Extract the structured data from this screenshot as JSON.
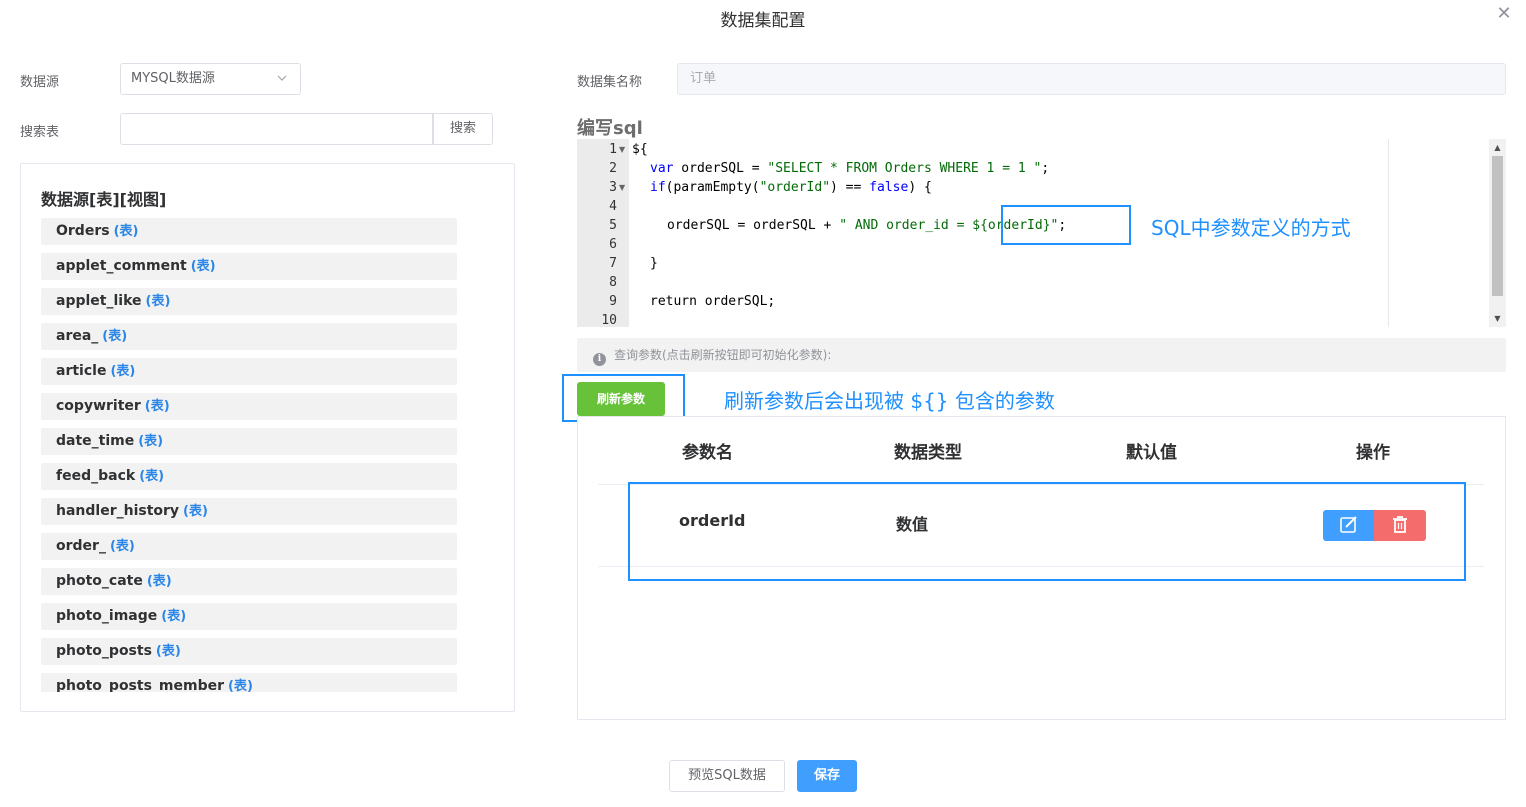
{
  "dialog": {
    "title": "数据集配置",
    "close_icon": "close-icon"
  },
  "left": {
    "datasource_label": "数据源",
    "datasource_value": "MYSQL数据源",
    "search_label": "搜索表",
    "search_value": "",
    "search_button": "搜索",
    "tree_heading": "数据源[表][视图]",
    "table_tag": "(表)",
    "tables": [
      "Orders",
      "applet_comment",
      "applet_like",
      "area_",
      "article",
      "copywriter",
      "date_time",
      "feed_back",
      "handler_history",
      "order_",
      "photo_cate",
      "photo_image",
      "photo_posts",
      "photo_posts_member"
    ]
  },
  "right": {
    "dataset_name_label": "数据集名称",
    "dataset_name_value": "订单",
    "sql_heading": "编写sql",
    "line_numbers": [
      "1",
      "2",
      "3",
      "4",
      "5",
      "6",
      "7",
      "8",
      "9",
      "10"
    ],
    "code": {
      "l1": "${",
      "l2_kw": "var",
      "l2_a": " orderSQL = ",
      "l2_str": "\"SELECT * FROM Orders WHERE 1 = 1 \"",
      "l2_b": ";",
      "l3_kw": "if",
      "l3_a": "(paramEmpty(",
      "l3_str": "\"orderId\"",
      "l3_b": ") == ",
      "l3_kw2": "false",
      "l3_c": ") {",
      "l5_a": "orderSQL = orderSQL + ",
      "l5_str": "\" AND order_id = ${orderId}\"",
      "l5_b": ";",
      "l7": "}",
      "l9": "return orderSQL;"
    },
    "annotation_sql": "SQL中参数定义的方式",
    "params_hint": "查询参数(点击刷新按钮即可初始化参数):",
    "refresh_button": "刷新参数",
    "annotation_refresh": "刷新参数后会出现被 ${} 包含的参数",
    "table": {
      "headers": [
        "参数名",
        "数据类型",
        "默认值",
        "操作"
      ],
      "rows": [
        {
          "name": "orderId",
          "type": "数值",
          "default": ""
        }
      ]
    }
  },
  "footer": {
    "preview_button": "预览SQL数据",
    "save_button": "保存"
  },
  "colors": {
    "primary": "#409eff",
    "success": "#67c23a",
    "danger": "#f56c6c",
    "annotation": "#1e90ff",
    "table_tag": "#2b86e7"
  }
}
